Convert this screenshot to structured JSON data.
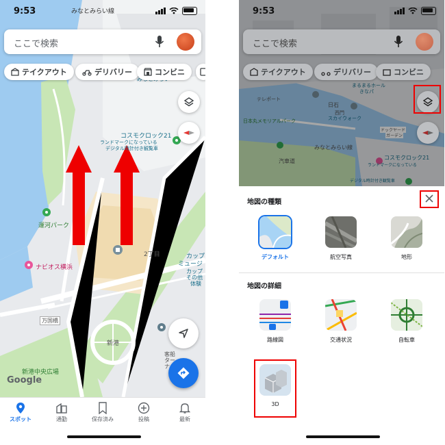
{
  "status": {
    "time": "9:53",
    "location": "みなとみらい線"
  },
  "search": {
    "placeholder": "ここで検索"
  },
  "chips": [
    {
      "label": "テイクアウト",
      "icon": "takeout-icon"
    },
    {
      "label": "デリバリー",
      "icon": "delivery-icon"
    },
    {
      "label": "コンビニ",
      "icon": "store-icon"
    }
  ],
  "map_left": {
    "labels": {
      "cosmo_clock": "コスモクロック21",
      "landmark_line1": "ランドマークになっている",
      "landmark_line2": "デジタル時計付き観覧車",
      "top_clip": "みなとみらい",
      "unga_park": "運河パーク",
      "navios": "ナビオス横浜",
      "block2": "2丁目",
      "cup_line1": "カップ",
      "cup_line2": "ミュージ",
      "cup_line3": "カップ",
      "cup_line4": "その他",
      "cup_line5": "体験",
      "bankokubashi": "万国橋",
      "shinko": "新港",
      "shinko_park": "新港中央広場",
      "terminal_line1": "客船",
      "terminal_line2": "ター",
      "terminal_line3": "ナル",
      "google": "Google"
    }
  },
  "map_right": {
    "labels": {
      "marine_line1": "まるまるホール",
      "marine_line2": "きなパ",
      "nisshin": "日石",
      "shimmeihall": "西門",
      "seacle": "ドックヤード",
      "seacle2": "ガーデン",
      "nippon_maru": "日本丸メモリアルパーク",
      "skywalk": "スカイウォーク",
      "gateway": "汽車道",
      "mm_line": "みなとみらい線",
      "cosmo_line1": "コスモクロック21",
      "cosmo_line2": "ランドマークになっている",
      "cosmo_line3": "デジタル時計付き観覧車",
      "tech": "テレポート"
    }
  },
  "layers_sheet": {
    "map_type_title": "地図の種類",
    "map_types": [
      {
        "label": "デフォルト",
        "selected": true
      },
      {
        "label": "航空写真",
        "selected": false
      },
      {
        "label": "地形",
        "selected": false
      }
    ],
    "map_details_title": "地図の詳細",
    "map_details": [
      {
        "label": "路線図"
      },
      {
        "label": "交通状況"
      },
      {
        "label": "自転車"
      },
      {
        "label": "3D"
      }
    ]
  },
  "bottom_nav": [
    {
      "label": "スポット",
      "active": true
    },
    {
      "label": "通勤",
      "active": false
    },
    {
      "label": "保存済み",
      "active": false
    },
    {
      "label": "投稿",
      "active": false
    },
    {
      "label": "最新",
      "active": false
    }
  ],
  "colors": {
    "accent": "#1a73e8",
    "water": "#9ecbf0",
    "land": "#e8eaed",
    "park": "#c8e6b5",
    "highlight": "#ee0000"
  }
}
